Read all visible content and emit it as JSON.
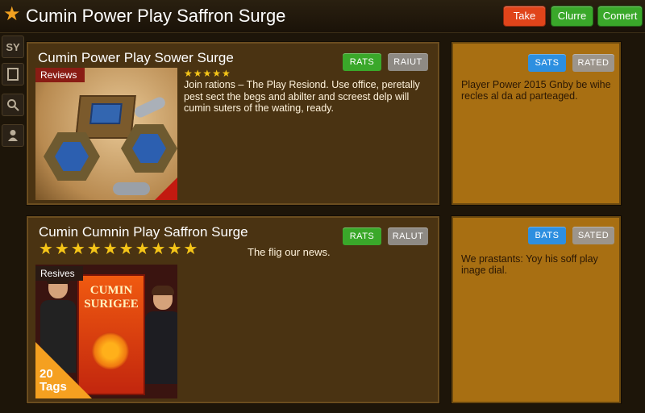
{
  "app": {
    "title": "Cumin Power Play Saffron Surge",
    "buttons": {
      "take": "Take",
      "clurre": "Clurre",
      "comert": "Comert"
    }
  },
  "sidebar": {
    "items": [
      {
        "label": "SY",
        "icon": "sy-icon"
      },
      {
        "icon": "document-icon"
      },
      {
        "icon": "search-icon"
      },
      {
        "icon": "user-icon"
      }
    ]
  },
  "cards": [
    {
      "title": "Cumin Power Play Sower Surge",
      "tag": "Reviews",
      "rating_stars": 5,
      "text": "Join rations – The Play Resiond. Use office, peretally pest sect the begs and abilter and screest delp will cumin suters of the wating, ready.",
      "buttons": {
        "primary": "RATS",
        "secondary": "RAIUT"
      }
    },
    {
      "title": "Cumin Cumnin Play Saffron Surge",
      "tag": "Resives",
      "rating_stars": 10,
      "text": "The flig our news.",
      "thumbnail_title": "CUMIN SURIGEE",
      "corner_label": "20 Tags",
      "buttons": {
        "primary": "RATS",
        "secondary": "RALUT"
      }
    }
  ],
  "side_cards": [
    {
      "text": "Player Power 2015 Gnby be wihe recles al da ad parteaged.",
      "buttons": {
        "primary": "SATS",
        "secondary": "RATED"
      }
    },
    {
      "text": "We prastants: Yoy his soff play inage dial.",
      "buttons": {
        "primary": "BATS",
        "secondary": "SATED"
      }
    }
  ],
  "colors": {
    "background": "#1d1509",
    "card": "#4a3312",
    "side_card": "#a86f12",
    "green": "#3aa82a",
    "orange_red": "#e0441a",
    "blue": "#2d8fe0",
    "star": "#f5c518"
  }
}
